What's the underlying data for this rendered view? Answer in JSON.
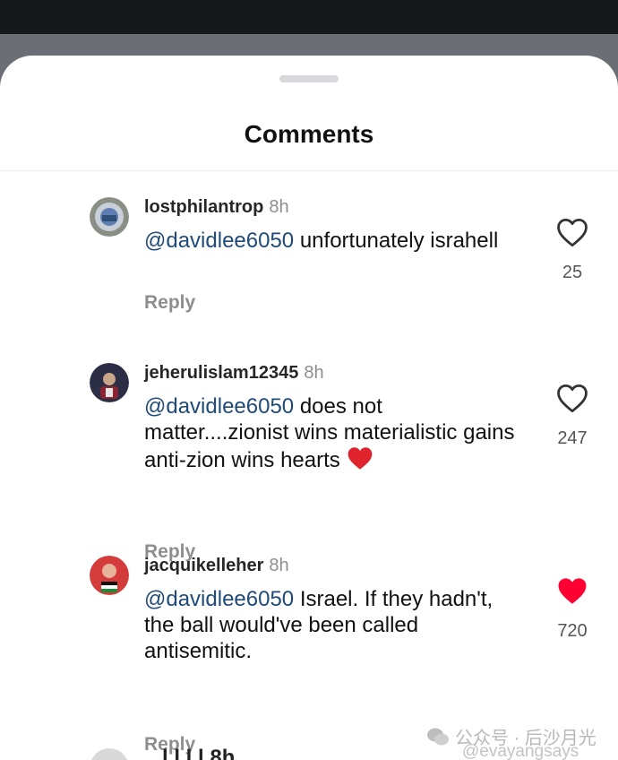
{
  "header": {
    "title": "Comments"
  },
  "comments": [
    {
      "username": "lostphilantrop",
      "time": "8h",
      "mention": "@davidlee6050",
      "text": " unfortunately israhell",
      "reply_label": "Reply",
      "likes": "25",
      "liked": false
    },
    {
      "username": "jeherulislam12345",
      "time": "8h",
      "mention": "@davidlee6050",
      "text": " does not matter....zionist wins materialistic gains anti-zion wins hearts",
      "emoji": "red-heart",
      "reply_label": "Reply",
      "likes": "247",
      "liked": false
    },
    {
      "username": "jacquikelleher",
      "time": "8h",
      "mention": "@davidlee6050",
      "text": " Israel. If they hadn't, the ball would've been called antisemitic.",
      "reply_label": "Reply",
      "likes": "720",
      "liked": true
    }
  ],
  "partial_comment": {
    "username_fragment": "...l.l.l.l 8h"
  },
  "watermark": {
    "text": "公众号 · 后沙月光",
    "handle": "@evayangsays"
  },
  "colors": {
    "mention": "#1f4a7a",
    "like_active": "#ff0033",
    "meta_gray": "#8e8e8e"
  },
  "icons": {
    "like": "heart-outline-icon",
    "liked": "heart-filled-icon"
  }
}
